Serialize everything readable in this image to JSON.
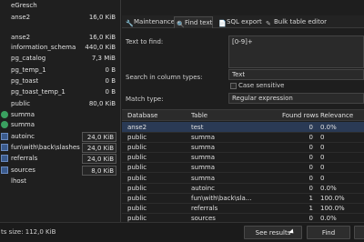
{
  "tree": {
    "nodes": [
      {
        "kind": "db",
        "name": "eGresch",
        "size": ""
      },
      {
        "kind": "db",
        "name": "anse2",
        "size": "16,0 KiB"
      },
      {
        "kind": "db",
        "name": "anse2",
        "size": "16,0 KiB"
      },
      {
        "kind": "db",
        "name": "information_schema",
        "size": "440,0 KiB"
      },
      {
        "kind": "db",
        "name": "pg_catalog",
        "size": "7,3 MiB"
      },
      {
        "kind": "db",
        "name": "pg_temp_1",
        "size": "0 B"
      },
      {
        "kind": "db",
        "name": "pg_toast",
        "size": "0 B"
      },
      {
        "kind": "db",
        "name": "pg_toast_temp_1",
        "size": "0 B"
      },
      {
        "kind": "db",
        "name": "public",
        "size": "80,0 KiB"
      },
      {
        "kind": "db",
        "name": "summa",
        "size": ""
      },
      {
        "kind": "db",
        "name": "summa",
        "size": ""
      },
      {
        "kind": "tbl",
        "name": "autoinc",
        "size": "24,0 KiB"
      },
      {
        "kind": "tbl",
        "name": "fun\\with\\back\\slashes",
        "size": "24,0 KiB"
      },
      {
        "kind": "tbl",
        "name": "referrals",
        "size": "24,0 KiB"
      },
      {
        "kind": "tbl",
        "name": "sources",
        "size": "8,0 KiB"
      },
      {
        "kind": "db",
        "name": "lhost",
        "size": ""
      }
    ]
  },
  "tabs": [
    {
      "icon": "wrench-icon",
      "glyph": "🔧",
      "label": "Maintenance"
    },
    {
      "icon": "search-icon",
      "glyph": "🔍",
      "label": "Find text"
    },
    {
      "icon": "export-icon",
      "glyph": "📄",
      "label": "SQL export"
    },
    {
      "icon": "table-edit-icon",
      "glyph": "✎",
      "label": "Bulk table editor"
    }
  ],
  "form": {
    "text_to_find_label": "Text to find:",
    "text_to_find_value": "[0-9]+",
    "search_in_column_types_label": "Search in column types:",
    "column_types_value": "Text",
    "case_sensitive_label": "Case sensitive",
    "match_type_label": "Match type:",
    "match_type_value": "Regular expression"
  },
  "grid": {
    "columns": [
      "Database",
      "Table",
      "Found rows",
      "Relevance"
    ],
    "rows": [
      [
        "anse2",
        "test",
        "0",
        "0.0%"
      ],
      [
        "public",
        "summa",
        "0",
        "0"
      ],
      [
        "public",
        "summa",
        "0",
        "0"
      ],
      [
        "public",
        "summa",
        "0",
        "0"
      ],
      [
        "public",
        "summa",
        "0",
        "0"
      ],
      [
        "public",
        "summa",
        "0",
        "0"
      ],
      [
        "public",
        "autoinc",
        "0",
        "0.0%"
      ],
      [
        "public",
        "fun\\with\\back\\sla...",
        "1",
        "100.0%"
      ],
      [
        "public",
        "referrals",
        "1",
        "100.0%"
      ],
      [
        "public",
        "sources",
        "0",
        "0.0%"
      ]
    ]
  },
  "status": {
    "text": "ts size: 112,0 KiB"
  },
  "buttons": {
    "see_results": "See results",
    "find": "Find"
  },
  "colors": {
    "background": "#1e1e1e",
    "selection": "#2a3a55",
    "table_icon": "#3a5a8c",
    "db_icon": "#3aa060"
  }
}
